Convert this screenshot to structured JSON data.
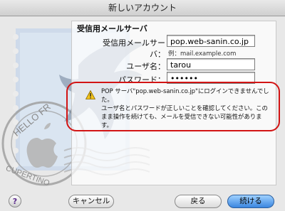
{
  "window": {
    "title": "新しいアカウント"
  },
  "section": {
    "title": "受信用メールサーバ"
  },
  "form": {
    "server_label": "受信用メールサーバ：",
    "server_value": "pop.web-sanin.co.jp",
    "server_hint": "例：mail.example.com",
    "user_label": "ユーザ名：",
    "user_value": "tarou",
    "password_label": "パスワード：",
    "password_value": "••••••"
  },
  "warning": {
    "text": "POP サーバ\"pop.web-sanin.co.jp\"にログインできませんでした。\nユーザ名とパスワードが正しいことを確認してください。この\nまま操作を続けても、メールを受信できない可能性がありま\nす。",
    "icon": "warning-triangle-icon"
  },
  "stamp": {
    "top_text": "HELLO FR",
    "bottom_text": "CUPERTINO"
  },
  "help": {
    "label": "?"
  },
  "buttons": {
    "cancel": "キャンセル",
    "back": "戻る",
    "continue": "続ける"
  },
  "colors": {
    "highlight": "#d21414",
    "primary": "#3a86e0"
  }
}
